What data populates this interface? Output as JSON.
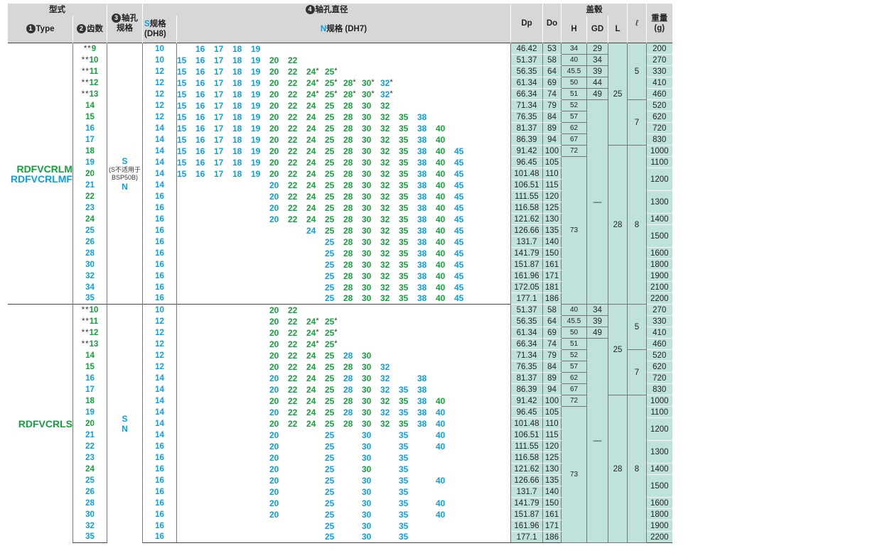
{
  "headers": {
    "type_group": "型式",
    "type": "Type",
    "teeth": "齿数",
    "shaft_hole": "轴孔",
    "spec": "规格",
    "bore_diameter": "轴孔直径",
    "s_spec_prefix": "S",
    "s_spec": "规格",
    "s_tol": "(DH8)",
    "n_spec_prefix": "N",
    "n_spec": "规格 (DH7)",
    "dp": "Dp",
    "do": "Do",
    "cover": "盖毂",
    "h": "H",
    "gd": "GD",
    "l": "L",
    "ell": "ℓ",
    "weight": "重量",
    "weight_unit": "(g)",
    "num1": "1",
    "num2": "2",
    "num3": "3",
    "num4": "4"
  },
  "groups": [
    {
      "type_lines": [
        "RDFVCRLM",
        "RDFVCRLMF"
      ],
      "type_colors": [
        "#12a23c",
        "#0aa0e0"
      ],
      "std_lines": [
        "S",
        "(S不适用于",
        "BSP50B)",
        "N"
      ],
      "rows": [
        {
          "stars": "**",
          "teeth": "9",
          "tc": "g",
          "s": "10",
          "bore": [
            "16b",
            "17b",
            "18b",
            "19b"
          ],
          "off": 0,
          "dp": "46.42",
          "do": "53",
          "weight": "200"
        },
        {
          "stars": "**",
          "teeth": "10",
          "tc": "g",
          "s": "10",
          "bore": [
            "15b",
            "16b",
            "17b",
            "18b",
            "19b",
            "20g",
            "22g"
          ],
          "off": -1,
          "dp": "51.37",
          "do": "58",
          "weight": "270"
        },
        {
          "stars": "**",
          "teeth": "11",
          "tc": "g",
          "s": "12",
          "bore": [
            "15b",
            "16b",
            "17b",
            "18b",
            "19b",
            "20g",
            "22g",
            "24*g",
            "25*g"
          ],
          "off": -1,
          "dp": "56.35",
          "do": "64",
          "weight": "330"
        },
        {
          "stars": "**",
          "teeth": "12",
          "tc": "g",
          "s": "12",
          "bore": [
            "15b",
            "16b",
            "17b",
            "18b",
            "19b",
            "20g",
            "22g",
            "24*g",
            "25*g",
            "28*g",
            "30*g",
            "32*b"
          ],
          "off": -1,
          "dp": "61.34",
          "do": "69",
          "weight": "410"
        },
        {
          "stars": "**",
          "teeth": "13",
          "tc": "g",
          "s": "12",
          "bore": [
            "15b",
            "16b",
            "17b",
            "18b",
            "19b",
            "20g",
            "22g",
            "24*g",
            "25*g",
            "28*g",
            "30*g",
            "32*b"
          ],
          "off": -1,
          "dp": "66.34",
          "do": "74",
          "weight": "460"
        },
        {
          "stars": "",
          "teeth": "14",
          "tc": "g",
          "s": "12",
          "bore": [
            "15b",
            "16b",
            "17b",
            "18b",
            "19b",
            "20g",
            "22g",
            "24g",
            "25g",
            "28g",
            "30g",
            "32g"
          ],
          "off": -1,
          "dp": "71.34",
          "do": "79",
          "weight": "520"
        },
        {
          "stars": "",
          "teeth": "15",
          "tc": "g",
          "s": "12",
          "bore": [
            "15b",
            "16b",
            "17b",
            "18b",
            "19b",
            "20g",
            "22g",
            "24g",
            "25g",
            "28g",
            "30g",
            "32g",
            "35g",
            "38b"
          ],
          "off": -1,
          "dp": "76.35",
          "do": "84",
          "weight": "620"
        },
        {
          "stars": "",
          "teeth": "16",
          "tc": "b",
          "s": "14",
          "bore": [
            "15b",
            "16b",
            "17b",
            "18b",
            "19b",
            "20g",
            "22g",
            "24g",
            "25g",
            "28g",
            "30g",
            "32g",
            "35g",
            "38b",
            "40g"
          ],
          "off": -1,
          "dp": "81.37",
          "do": "89",
          "weight": "720"
        },
        {
          "stars": "",
          "teeth": "17",
          "tc": "b",
          "s": "14",
          "bore": [
            "15b",
            "16b",
            "17b",
            "18b",
            "19b",
            "20g",
            "22g",
            "24g",
            "25g",
            "28g",
            "30g",
            "32g",
            "35g",
            "38b",
            "40g"
          ],
          "off": -1,
          "dp": "86.39",
          "do": "94",
          "weight": "830"
        },
        {
          "stars": "",
          "teeth": "18",
          "tc": "g",
          "s": "14",
          "bore": [
            "15b",
            "16b",
            "17b",
            "18b",
            "19b",
            "20g",
            "22g",
            "24g",
            "25g",
            "28g",
            "30g",
            "32g",
            "35g",
            "38b",
            "40g",
            "45b"
          ],
          "off": -1,
          "dp": "91.42",
          "do": "100",
          "weight": "1000"
        },
        {
          "stars": "",
          "teeth": "19",
          "tc": "b",
          "s": "14",
          "bore": [
            "15b",
            "16b",
            "17b",
            "18b",
            "19b",
            "20g",
            "22g",
            "24g",
            "25g",
            "28g",
            "30g",
            "32g",
            "35g",
            "38b",
            "40g",
            "45b"
          ],
          "off": -1,
          "dp": "96.45",
          "do": "105",
          "weight": "1100"
        },
        {
          "stars": "",
          "teeth": "20",
          "tc": "g",
          "s": "14",
          "bore": [
            "15b",
            "16b",
            "17b",
            "18b",
            "19b",
            "20g",
            "22g",
            "24g",
            "25g",
            "28g",
            "30g",
            "32g",
            "35g",
            "38b",
            "40g",
            "45b"
          ],
          "off": -1,
          "dp": "101.48",
          "do": "110",
          "weight": "1200"
        },
        {
          "stars": "",
          "teeth": "21",
          "tc": "b",
          "s": "14",
          "bore": [
            "20b",
            "22g",
            "24g",
            "25g",
            "28g",
            "30g",
            "32g",
            "35g",
            "38b",
            "40g",
            "45b"
          ],
          "off": 4,
          "dp": "106.51",
          "do": "115",
          "weight": ""
        },
        {
          "stars": "",
          "teeth": "22",
          "tc": "g",
          "s": "16",
          "bore": [
            "20b",
            "22g",
            "24g",
            "25g",
            "28g",
            "30g",
            "32g",
            "35g",
            "38b",
            "40g",
            "45b"
          ],
          "off": 4,
          "dp": "111.55",
          "do": "120",
          "weight": "1300"
        },
        {
          "stars": "",
          "teeth": "23",
          "tc": "b",
          "s": "16",
          "bore": [
            "20b",
            "22g",
            "24g",
            "25g",
            "28g",
            "30g",
            "32g",
            "35g",
            "38b",
            "40g",
            "45b"
          ],
          "off": 4,
          "dp": "116.58",
          "do": "125",
          "weight": ""
        },
        {
          "stars": "",
          "teeth": "24",
          "tc": "g",
          "s": "16",
          "bore": [
            "20b",
            "22g",
            "24g",
            "25g",
            "28g",
            "30g",
            "32g",
            "35g",
            "38b",
            "40g",
            "45b"
          ],
          "off": 4,
          "dp": "121.62",
          "do": "130",
          "weight": "1400"
        },
        {
          "stars": "",
          "teeth": "25",
          "tc": "b",
          "s": "16",
          "bore": [
            "24b",
            "25g",
            "28g",
            "30g",
            "32g",
            "35g",
            "38b",
            "40g",
            "45b"
          ],
          "off": 6,
          "dp": "126.66",
          "do": "135",
          "weight": "1500"
        },
        {
          "stars": "",
          "teeth": "26",
          "tc": "b",
          "s": "16",
          "bore": [
            "25b",
            "28g",
            "30g",
            "32g",
            "35g",
            "38b",
            "40g",
            "45b"
          ],
          "off": 7,
          "dp": "131.7",
          "do": "140",
          "weight": ""
        },
        {
          "stars": "",
          "teeth": "28",
          "tc": "b",
          "s": "16",
          "bore": [
            "25b",
            "28g",
            "30g",
            "32g",
            "35g",
            "38b",
            "40g",
            "45b"
          ],
          "off": 7,
          "dp": "141.79",
          "do": "150",
          "weight": "1600"
        },
        {
          "stars": "",
          "teeth": "30",
          "tc": "b",
          "s": "16",
          "bore": [
            "25b",
            "28g",
            "30g",
            "32g",
            "35g",
            "38b",
            "40g",
            "45b"
          ],
          "off": 7,
          "dp": "151.87",
          "do": "161",
          "weight": "1800"
        },
        {
          "stars": "",
          "teeth": "32",
          "tc": "b",
          "s": "16",
          "bore": [
            "25b",
            "28g",
            "30g",
            "32g",
            "35g",
            "38b",
            "40g",
            "45b"
          ],
          "off": 7,
          "dp": "161.96",
          "do": "171",
          "weight": "1900"
        },
        {
          "stars": "",
          "teeth": "34",
          "tc": "b",
          "s": "16",
          "bore": [
            "25b",
            "28g",
            "30g",
            "32g",
            "35g",
            "38b",
            "40g",
            "45b"
          ],
          "off": 7,
          "dp": "172.05",
          "do": "181",
          "weight": "2100"
        },
        {
          "stars": "",
          "teeth": "35",
          "tc": "b",
          "s": "16",
          "bore": [
            "25b",
            "28g",
            "30g",
            "32g",
            "35g",
            "38b",
            "40g",
            "45b"
          ],
          "off": 7,
          "dp": "177.1",
          "do": "186",
          "weight": "2200"
        }
      ]
    },
    {
      "type_lines": [
        "RDFVCRLS"
      ],
      "type_colors": [
        "#12a23c"
      ],
      "std_lines": [
        "S",
        "N"
      ],
      "rows": [
        {
          "stars": "**",
          "teeth": "10",
          "tc": "g",
          "s": "10",
          "bore": [
            "20g",
            "22g"
          ],
          "off": 4,
          "dp": "51.37",
          "do": "58",
          "weight": "270"
        },
        {
          "stars": "**",
          "teeth": "11",
          "tc": "g",
          "s": "12",
          "bore": [
            "20g",
            "22g",
            "24*g",
            "25*g"
          ],
          "off": 4,
          "dp": "56.35",
          "do": "64",
          "weight": "330"
        },
        {
          "stars": "**",
          "teeth": "12",
          "tc": "g",
          "s": "12",
          "bore": [
            "20g",
            "22g",
            "24*g",
            "25*g"
          ],
          "off": 4,
          "dp": "61.34",
          "do": "69",
          "weight": "410"
        },
        {
          "stars": "**",
          "teeth": "13",
          "tc": "g",
          "s": "12",
          "bore": [
            "20g",
            "22g",
            "24*g",
            "25*g"
          ],
          "off": 4,
          "dp": "66.34",
          "do": "74",
          "weight": "460"
        },
        {
          "stars": "",
          "teeth": "14",
          "tc": "g",
          "s": "12",
          "bore": [
            "20g",
            "22g",
            "24g",
            "25g",
            "28b",
            "30g"
          ],
          "off": 4,
          "dp": "71.34",
          "do": "79",
          "weight": "520"
        },
        {
          "stars": "",
          "teeth": "15",
          "tc": "g",
          "s": "12",
          "bore": [
            "20g",
            "22g",
            "24g",
            "25g",
            "28g",
            "30g",
            "32b"
          ],
          "off": 4,
          "dp": "76.35",
          "do": "84",
          "weight": "620"
        },
        {
          "stars": "",
          "teeth": "16",
          "tc": "b",
          "s": "14",
          "bore": [
            "20b",
            "22g",
            "24g",
            "25g",
            "28b",
            "30g",
            "32b",
            "",
            "38b"
          ],
          "off": 4,
          "dp": "81.37",
          "do": "89",
          "weight": "720"
        },
        {
          "stars": "",
          "teeth": "17",
          "tc": "b",
          "s": "14",
          "bore": [
            "20b",
            "22g",
            "24g",
            "25g",
            "28b",
            "30g",
            "32b",
            "35b",
            "38b"
          ],
          "off": 4,
          "dp": "86.39",
          "do": "94",
          "weight": "830"
        },
        {
          "stars": "",
          "teeth": "18",
          "tc": "g",
          "s": "14",
          "bore": [
            "20g",
            "22g",
            "24g",
            "25g",
            "28g",
            "30g",
            "32g",
            "35g",
            "38b",
            "40g"
          ],
          "off": 4,
          "dp": "91.42",
          "do": "100",
          "weight": "1000"
        },
        {
          "stars": "",
          "teeth": "19",
          "tc": "b",
          "s": "14",
          "bore": [
            "20b",
            "22g",
            "24g",
            "25g",
            "28b",
            "30g",
            "32b",
            "35b",
            "38b",
            "40b"
          ],
          "off": 4,
          "dp": "96.45",
          "do": "105",
          "weight": "1100"
        },
        {
          "stars": "",
          "teeth": "20",
          "tc": "g",
          "s": "14",
          "bore": [
            "20g",
            "22g",
            "24g",
            "25g",
            "28g",
            "30g",
            "32g",
            "35g",
            "38b",
            "40b"
          ],
          "off": 4,
          "dp": "101.48",
          "do": "110",
          "weight": "1200"
        },
        {
          "stars": "",
          "teeth": "21",
          "tc": "b",
          "s": "14",
          "bore": [
            "20b",
            "",
            "",
            "25b",
            "",
            "30b",
            "",
            "35b",
            "",
            "40b"
          ],
          "off": 4,
          "dp": "106.51",
          "do": "115",
          "weight": ""
        },
        {
          "stars": "",
          "teeth": "22",
          "tc": "b",
          "s": "16",
          "bore": [
            "20b",
            "",
            "",
            "25b",
            "",
            "30b",
            "",
            "35b",
            "",
            "40b"
          ],
          "off": 4,
          "dp": "111.55",
          "do": "120",
          "weight": "1300"
        },
        {
          "stars": "",
          "teeth": "23",
          "tc": "b",
          "s": "16",
          "bore": [
            "20b",
            "",
            "",
            "25b",
            "",
            "30b",
            "",
            "35b"
          ],
          "off": 4,
          "dp": "116.58",
          "do": "125",
          "weight": ""
        },
        {
          "stars": "",
          "teeth": "24",
          "tc": "g",
          "s": "16",
          "bore": [
            "20b",
            "",
            "",
            "25b",
            "",
            "30g",
            "",
            "35b"
          ],
          "off": 4,
          "dp": "121.62",
          "do": "130",
          "weight": "1400"
        },
        {
          "stars": "",
          "teeth": "25",
          "tc": "b",
          "s": "16",
          "bore": [
            "20b",
            "",
            "",
            "25b",
            "",
            "30b",
            "",
            "35b",
            "",
            "40b"
          ],
          "off": 4,
          "dp": "126.66",
          "do": "135",
          "weight": "1500"
        },
        {
          "stars": "",
          "teeth": "26",
          "tc": "b",
          "s": "16",
          "bore": [
            "20b",
            "",
            "",
            "25b",
            "",
            "30b",
            "",
            "35b"
          ],
          "off": 4,
          "dp": "131.7",
          "do": "140",
          "weight": ""
        },
        {
          "stars": "",
          "teeth": "28",
          "tc": "b",
          "s": "16",
          "bore": [
            "20b",
            "",
            "",
            "25b",
            "",
            "30b",
            "",
            "35b",
            "",
            "40b"
          ],
          "off": 4,
          "dp": "141.79",
          "do": "150",
          "weight": "1600"
        },
        {
          "stars": "",
          "teeth": "30",
          "tc": "b",
          "s": "16",
          "bore": [
            "20b",
            "",
            "",
            "25b",
            "",
            "30b",
            "",
            "35b",
            "",
            "40b"
          ],
          "off": 4,
          "dp": "151.87",
          "do": "161",
          "weight": "1800"
        },
        {
          "stars": "",
          "teeth": "32",
          "tc": "b",
          "s": "16",
          "bore": [
            "",
            "",
            "",
            "25b",
            "",
            "30b",
            "",
            "35b"
          ],
          "off": 4,
          "dp": "161.96",
          "do": "171",
          "weight": "1900"
        },
        {
          "stars": "",
          "teeth": "35",
          "tc": "b",
          "s": "16",
          "bore": [
            "",
            "",
            "",
            "25b",
            "",
            "30b",
            "",
            "35b"
          ],
          "off": 4,
          "dp": "177.1",
          "do": "186",
          "weight": "2200"
        }
      ]
    }
  ],
  "merged": {
    "h_values": [
      "34",
      "40",
      "45.5",
      "50",
      "51",
      "52",
      "57",
      "62",
      "67",
      "72",
      "73"
    ],
    "gd_values": [
      "29",
      "34",
      "39",
      "44",
      "49",
      "—"
    ],
    "l_values": [
      "25",
      "28"
    ],
    "ell_values": [
      "5",
      "7",
      "8"
    ]
  },
  "colors": {
    "blue": "#0aa0e0",
    "green": "#12a23c",
    "teal_bg": "#bfe3dc",
    "header_bg": "#d7d7d7"
  }
}
